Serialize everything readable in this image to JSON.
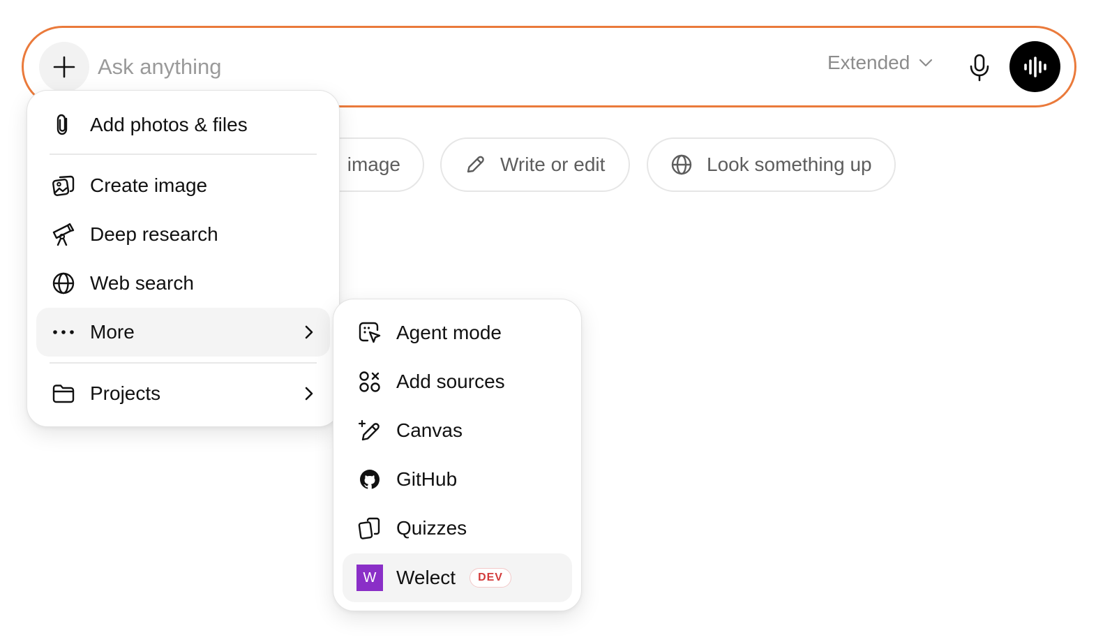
{
  "composer": {
    "placeholder": "Ask anything",
    "model_label": "Extended",
    "accent_color": "#ea7a3b"
  },
  "chips": [
    {
      "label": "image",
      "icon": "image-icon"
    },
    {
      "label": "Write or edit",
      "icon": "pencil-icon"
    },
    {
      "label": "Look something up",
      "icon": "globe-icon"
    }
  ],
  "main_menu": {
    "items": [
      {
        "label": "Add photos & files",
        "icon": "paperclip-icon"
      },
      {
        "label": "Create image",
        "icon": "image-create-icon"
      },
      {
        "label": "Deep research",
        "icon": "telescope-icon"
      },
      {
        "label": "Web search",
        "icon": "globe-icon"
      },
      {
        "label": "More",
        "icon": "more-dots-icon",
        "has_submenu": true
      },
      {
        "label": "Projects",
        "icon": "folder-icon",
        "has_submenu": true
      }
    ]
  },
  "sub_menu": {
    "items": [
      {
        "label": "Agent mode",
        "icon": "agent-cursor-icon"
      },
      {
        "label": "Add sources",
        "icon": "sources-icon"
      },
      {
        "label": "Canvas",
        "icon": "canvas-pen-icon"
      },
      {
        "label": "GitHub",
        "icon": "github-icon"
      },
      {
        "label": "Quizzes",
        "icon": "quiz-cards-icon"
      },
      {
        "label": "Welect",
        "icon": "welect-logo",
        "logo_letter": "W",
        "logo_color": "#8a2fc7",
        "badge": "DEV"
      }
    ]
  }
}
